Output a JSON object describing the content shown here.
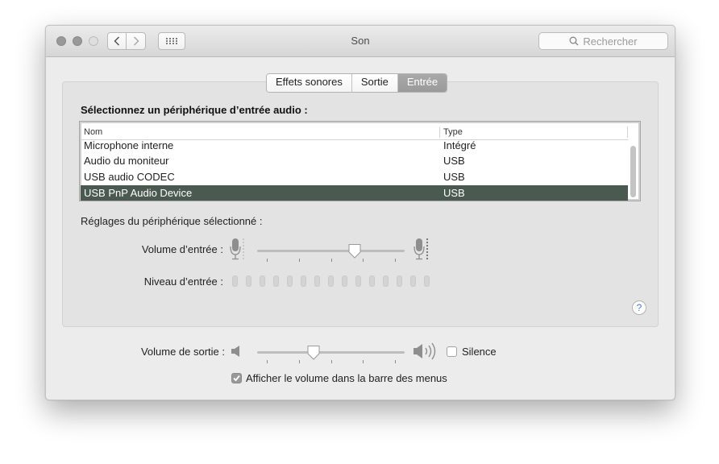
{
  "window": {
    "title": "Son"
  },
  "search": {
    "placeholder": "Rechercher"
  },
  "tabs": [
    {
      "label": "Effets sonores",
      "active": false
    },
    {
      "label": "Sortie",
      "active": false
    },
    {
      "label": "Entrée",
      "active": true
    }
  ],
  "input": {
    "heading": "Sélectionnez un périphérique d’entrée audio :",
    "columns": [
      "Nom",
      "Type"
    ],
    "devices": [
      {
        "name": "Microphone interne",
        "type": "Intégré",
        "selected": false
      },
      {
        "name": "Audio du moniteur",
        "type": "USB",
        "selected": false
      },
      {
        "name": "USB audio CODEC",
        "type": "USB",
        "selected": false
      },
      {
        "name": "USB PnP Audio Device",
        "type": "USB",
        "selected": true
      }
    ],
    "settings_label": "Réglages du périphérique sélectionné :",
    "volume_label": "Volume d’entrée :",
    "volume_level": 0.66,
    "level_label": "Niveau d’entrée :",
    "level_cells": 15,
    "level_active": 0
  },
  "output": {
    "volume_label": "Volume de sortie :",
    "volume_level": 0.38,
    "mute_label": "Silence",
    "mute_checked": false,
    "menubar_label": "Afficher le volume dans la barre des menus",
    "menubar_checked": true
  },
  "help": {
    "label": "?"
  },
  "colors": {
    "selection": "#4b5a50",
    "tab_active": "#a3a3a3",
    "help": "#3a7fd6"
  }
}
